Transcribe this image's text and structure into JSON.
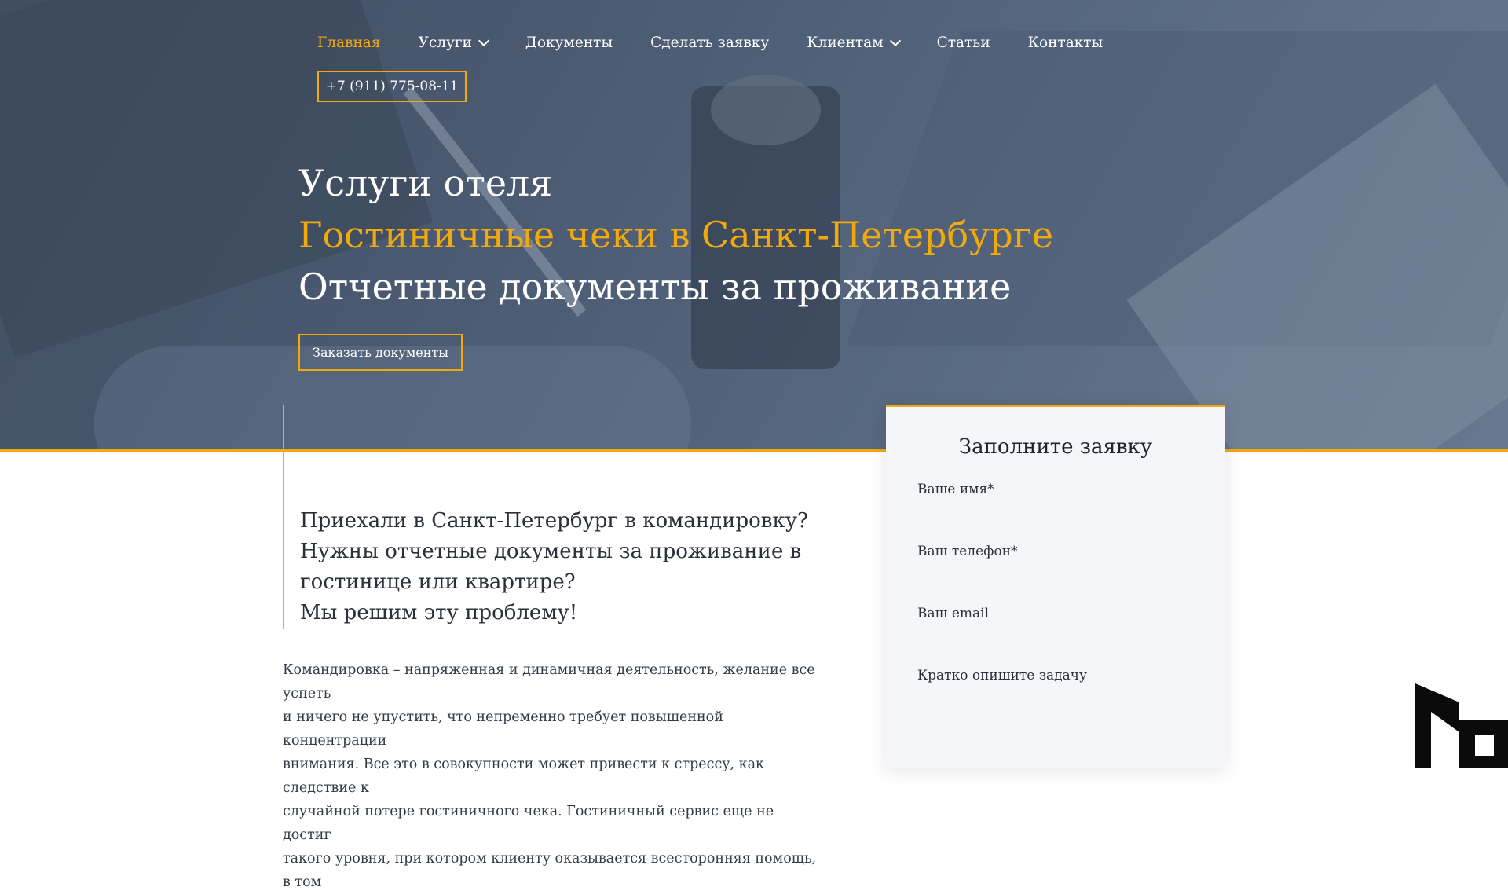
{
  "nav": {
    "items": [
      {
        "label": "Главная",
        "active": true,
        "dropdown": false
      },
      {
        "label": "Услуги",
        "active": false,
        "dropdown": true
      },
      {
        "label": "Документы",
        "active": false,
        "dropdown": false
      },
      {
        "label": "Сделать заявку",
        "active": false,
        "dropdown": false
      },
      {
        "label": "Клиентам",
        "active": false,
        "dropdown": true
      },
      {
        "label": "Статьи",
        "active": false,
        "dropdown": false
      },
      {
        "label": "Контакты",
        "active": false,
        "dropdown": false
      }
    ],
    "phone": "+7 (911) 775-08-11"
  },
  "hero": {
    "line1": "Услуги отеля",
    "line2": "Гостиничные чеки в Санкт-Петербурге",
    "line3": "Отчетные документы за проживание",
    "cta": "Заказать документы"
  },
  "lead": {
    "lines": [
      "Приехали в Санкт-Петербург в командировку?",
      "Нужны отчетные документы за проживание в",
      "гостинице или квартире?",
      "Мы решим эту проблему!"
    ]
  },
  "body": {
    "lines": [
      "Командировка – напряженная и динамичная деятельность, желание все успеть",
      "и ничего не упустить, что непременно требует повышенной концентрации",
      "внимания. Все это в совокупности может привести к стрессу, как следствие к",
      "случайной потере гостиничного чека. Гостиничный сервис еще не достиг",
      "такого уровня, при котором клиенту оказывается всесторонняя помощь, в том"
    ]
  },
  "form": {
    "title": "Заполните заявку",
    "name_label": "Ваше имя*",
    "phone_label": "Ваш телефон*",
    "email_label": "Ваш email",
    "task_label": "Кратко опишите задачу"
  },
  "colors": {
    "accent": "#f2a90a",
    "hero_overlay": "#3e4d66",
    "form_bg": "#f4f6f9"
  },
  "icons": {
    "dropdown": "chevron-down-icon",
    "logo": "brand-logo-icon"
  }
}
